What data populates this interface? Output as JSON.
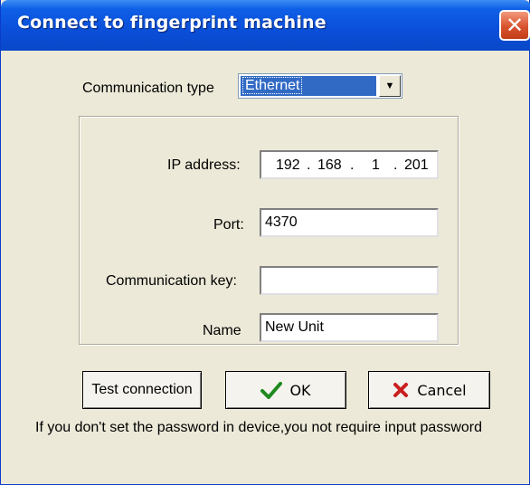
{
  "window": {
    "title": "Connect to fingerprint machine",
    "close_glyph": "✕"
  },
  "form": {
    "comm_type_label": "Communication type",
    "comm_type_value": "Ethernet",
    "ip_label": "IP address:",
    "ip_parts": [
      "192",
      "168",
      "1",
      "201"
    ],
    "ip_sep": ".",
    "port_label": "Port:",
    "port_value": "4370",
    "key_label": "Communication key:",
    "key_value": "",
    "name_label": "Name",
    "name_value": "New Unit"
  },
  "buttons": {
    "test_label": "Test connection",
    "ok_label": "OK",
    "ok_icon": "check-icon",
    "cancel_label": "Cancel",
    "cancel_icon": "x-icon"
  },
  "footnote": "If you don't set the password in device,you not require input password",
  "colors": {
    "title_blue": "#0a4fd9",
    "close_red": "#d8532e",
    "selection_blue": "#316ac5",
    "check_green": "#1e8a1e",
    "x_red": "#c8201e",
    "dialog_bg": "#ece9d8"
  }
}
